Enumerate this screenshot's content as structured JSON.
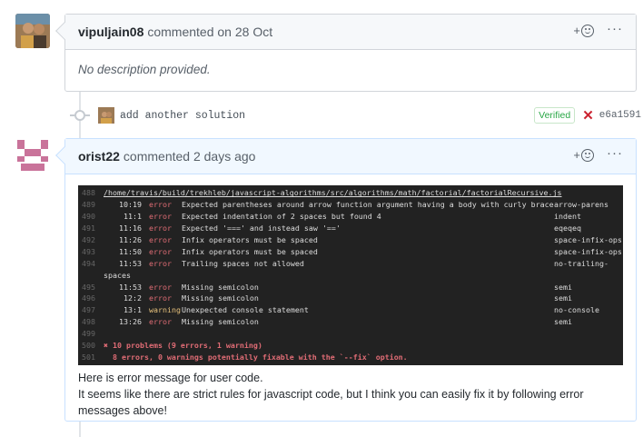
{
  "comment1": {
    "author": "vipuljain08",
    "action": "commented on 28 Oct",
    "body": "No description provided."
  },
  "commit": {
    "message": "add another solution",
    "verified_label": "Verified",
    "status_icon": "x-icon",
    "sha": "e6a1591"
  },
  "comment2": {
    "author": "orist22",
    "action": "commented 2 days ago",
    "terminal": {
      "path_line": {
        "ln": "488",
        "text": "/home/travis/build/trekhleb/javascript-algorithms/src/algorithms/math/factorial/factorialRecursive.js"
      },
      "issues": [
        {
          "ln": "489",
          "loc": "10:19",
          "severity": "error",
          "message": "Expected parentheses around arrow function argument having a body with curly braces",
          "rule": "arrow-parens"
        },
        {
          "ln": "490",
          "loc": "11:1",
          "severity": "error",
          "message": "Expected indentation of 2 spaces but found 4",
          "rule": "indent"
        },
        {
          "ln": "491",
          "loc": "11:16",
          "severity": "error",
          "message": "Expected '===' and instead saw '=='",
          "rule": "eqeqeq"
        },
        {
          "ln": "492",
          "loc": "11:26",
          "severity": "error",
          "message": "Infix operators must be spaced",
          "rule": "space-infix-ops"
        },
        {
          "ln": "493",
          "loc": "11:50",
          "severity": "error",
          "message": "Infix operators must be spaced",
          "rule": "space-infix-ops"
        },
        {
          "ln": "494",
          "loc": "11:53",
          "severity": "error",
          "message": "Trailing spaces not allowed",
          "rule": "no-trailing-"
        },
        {
          "ln": "",
          "loc": "",
          "severity": "",
          "message": "spaces",
          "rule": "",
          "continuation": true
        },
        {
          "ln": "495",
          "loc": "11:53",
          "severity": "error",
          "message": "Missing semicolon",
          "rule": "semi"
        },
        {
          "ln": "496",
          "loc": "12:2",
          "severity": "error",
          "message": "Missing semicolon",
          "rule": "semi"
        },
        {
          "ln": "497",
          "loc": "13:1",
          "severity": "warning",
          "message": "Unexpected console statement",
          "rule": "no-console"
        },
        {
          "ln": "498",
          "loc": "13:26",
          "severity": "error",
          "message": "Missing semicolon",
          "rule": "semi"
        }
      ],
      "blank_ln": "499",
      "summary1": {
        "ln": "500",
        "text": "✖ 10 problems (9 errors, 1 warning)"
      },
      "summary2": {
        "ln": "501",
        "text": "  8 errors, 0 warnings potentially fixable with the `--fix` option."
      }
    },
    "text_line1": "Here is error message for user code.",
    "text_line2": "It seems like there are strict rules for javascript code, but I think you can easily fix it by following error messages above!"
  },
  "actions": {
    "react_plus": "+",
    "more": "···"
  }
}
